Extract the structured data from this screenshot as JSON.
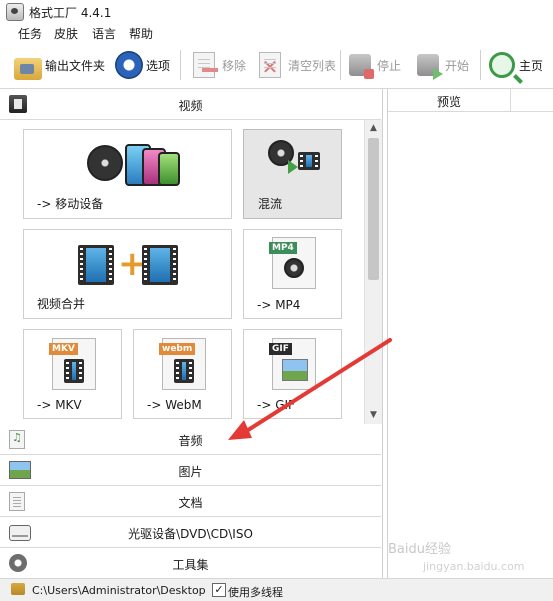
{
  "window": {
    "title": "格式工厂 4.4.1"
  },
  "menu": [
    "任务",
    "皮肤",
    "语言",
    "帮助"
  ],
  "toolbar": {
    "output_folder": "输出文件夹",
    "options": "选项",
    "remove": "移除",
    "clear_list": "清空列表",
    "stop": "停止",
    "start": "开始",
    "home": "主页"
  },
  "categories": {
    "video": "视频",
    "audio": "音频",
    "image": "图片",
    "document": "文档",
    "disc": "光驱设备\\DVD\\CD\\ISO",
    "tools": "工具集"
  },
  "tiles": [
    {
      "label": "-> 移动设备"
    },
    {
      "label": "混流"
    },
    {
      "label": "视频合并"
    },
    {
      "label": "-> MP4",
      "tag": "MP4"
    },
    {
      "label": "-> MKV",
      "tag": "MKV"
    },
    {
      "label": "-> WebM",
      "tag": "webm"
    },
    {
      "label": "-> GIF",
      "tag": "GIF"
    }
  ],
  "preview": {
    "header": "预览"
  },
  "status": {
    "path": "C:\\Users\\Administrator\\Desktop",
    "multithread_label": "使用多线程",
    "multithread_checked": true
  },
  "watermark": {
    "line1": "Baidu经验",
    "line2": "jingyan.baidu.com"
  },
  "colors": {
    "annotation_arrow": "#e53935",
    "selected_tile": "#e6e6e6"
  }
}
